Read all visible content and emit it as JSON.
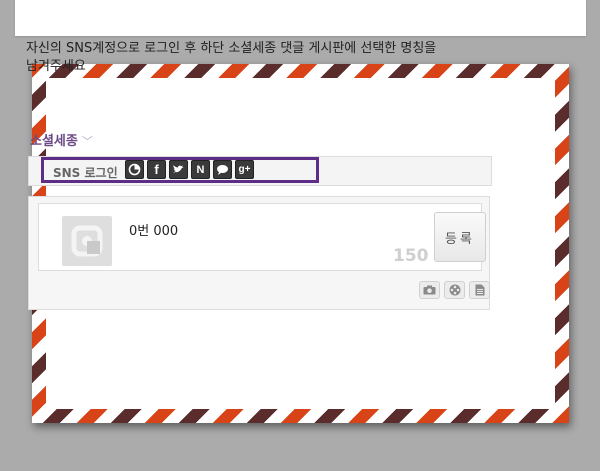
{
  "intro": {
    "line1": "자신의 SNS계정으로 로그인 후 하단 소셜세종 댓글 게시판에 선택한 명칭을",
    "line2": "남겨주세요"
  },
  "section": {
    "title": "소셜세종",
    "chevron": "﹀"
  },
  "login": {
    "label": "SNS 로그인",
    "providers": [
      {
        "name": "sns-circle",
        "glyph": "◔"
      },
      {
        "name": "facebook",
        "glyph": "f"
      },
      {
        "name": "twitter",
        "glyph": "🐦"
      },
      {
        "name": "naver",
        "glyph": "N"
      },
      {
        "name": "chat",
        "glyph": "💬"
      },
      {
        "name": "google-plus",
        "glyph": "g+"
      }
    ]
  },
  "comment": {
    "user_name": "0번 000",
    "char_count": "150",
    "register_label": "등록"
  },
  "colors": {
    "accent": "#5e2d87",
    "stripe_red": "#d84418",
    "stripe_brown": "#5a2c2c"
  }
}
